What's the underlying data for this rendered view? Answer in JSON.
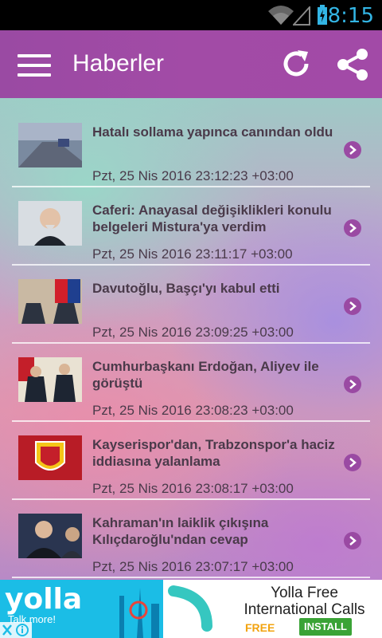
{
  "status_bar": {
    "time": "8:15"
  },
  "app_bar": {
    "title": "Haberler"
  },
  "news": [
    {
      "headline": "Hatalı sollama yapınca canından oldu",
      "date": "Pzt, 25 Nis 2016 23:12:23 +03:00"
    },
    {
      "headline": "Caferi: Anayasal değişiklikleri konulu belgeleri Mistura'ya verdim",
      "date": "Pzt, 25 Nis 2016 23:11:17 +03:00"
    },
    {
      "headline": "Davutoğlu,  Başçı'yı kabul etti",
      "date": "Pzt, 25 Nis 2016 23:09:25 +03:00"
    },
    {
      "headline": "Cumhurbaşkanı Erdoğan, Aliyev ile görüştü",
      "date": "Pzt, 25 Nis 2016 23:08:23 +03:00"
    },
    {
      "headline": "Kayserispor'dan, Trabzonspor'a haciz iddiasına yalanlama",
      "date": "Pzt, 25 Nis 2016 23:08:17 +03:00"
    },
    {
      "headline": "Kahraman'ın laiklik çıkışına Kılıçdaroğlu'ndan cevap",
      "date": "Pzt, 25 Nis 2016 23:07:17 +03:00"
    }
  ],
  "ad": {
    "logo": "yolla",
    "tagline": "Talk more!",
    "title": "Yolla Free International Calls",
    "free_label": "FREE",
    "install_label": "INSTALL"
  },
  "colors": {
    "accent": "#a24ba6",
    "status_blue": "#33b5e5",
    "install_green": "#3aa336"
  }
}
